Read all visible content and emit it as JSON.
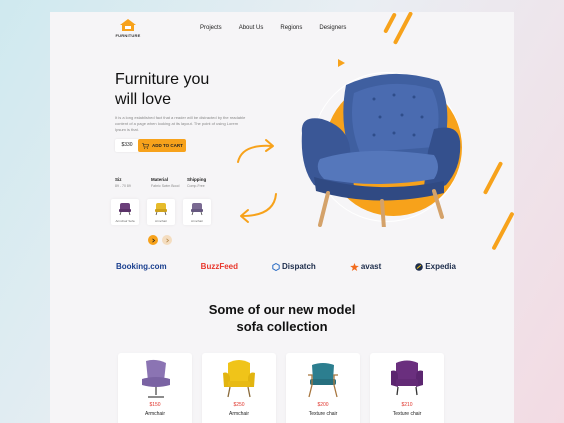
{
  "brand": {
    "logo_text": "FURNITURE"
  },
  "nav": {
    "items": [
      "Projects",
      "About Us",
      "Regions",
      "Designers"
    ]
  },
  "hero": {
    "title_line1": "Furniture you",
    "title_line2": "will love",
    "description": "It is a long established fact that a reader will be distracted by the readable content of a page when looking at its layout. The point of using Lorem Ipsum is that.",
    "price": "$330",
    "cta_label": "ADD TO CART"
  },
  "specs": [
    {
      "key": "Siz",
      "value": "89 - 70 89"
    },
    {
      "key": "Material",
      "value": "Fabric Swim Bood"
    },
    {
      "key": "Shipping",
      "value": "Comp-Free"
    }
  ],
  "thumbs": [
    {
      "label": "Armchair Sofa",
      "color": "#6b3f7a"
    },
    {
      "label": "Armchair",
      "color": "#e6bb2a"
    },
    {
      "label": "Armchair",
      "color": "#7a6a92"
    }
  ],
  "partners": [
    {
      "name": "Booking.com",
      "color": "#1a3f8f"
    },
    {
      "name": "BuzzFeed",
      "color": "#e8372c"
    },
    {
      "name": "Dispatch",
      "color": "#1c2c4b"
    },
    {
      "name": "avast",
      "color": "#1c2c4b"
    },
    {
      "name": "Expedia",
      "color": "#1c2c4b"
    }
  ],
  "collection": {
    "title_line1": "Some of our new model",
    "title_line2": "sofa collection",
    "items": [
      {
        "price": "$150",
        "name": "Armchair",
        "color": "#8b74b3"
      },
      {
        "price": "$250",
        "name": "Armchair",
        "color": "#f0c419"
      },
      {
        "price": "$200",
        "name": "Texture chair",
        "color": "#2c7e8f"
      },
      {
        "price": "$210",
        "name": "Texture chair",
        "color": "#6a2f7e"
      }
    ]
  },
  "colors": {
    "accent": "#f7a21b",
    "chair": "#3f5fa0",
    "price": "#e0372e"
  }
}
